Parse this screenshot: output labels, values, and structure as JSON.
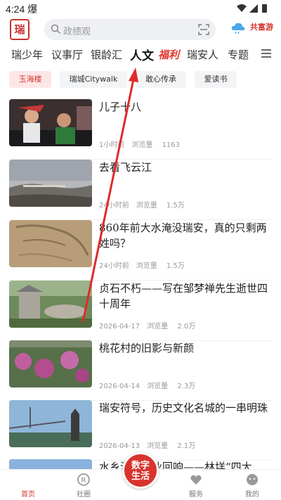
{
  "status_bar": {
    "time": "4:24",
    "extra_glyph": "爆"
  },
  "header": {
    "logo_text": "瑞",
    "search_placeholder": "政绩观",
    "promo_text": "共富游",
    "icons": {
      "search": "search-icon",
      "scan": "scan-icon",
      "weather": "cloud-icon"
    }
  },
  "tabs": [
    {
      "label": "瑞少年"
    },
    {
      "label": "议事厅"
    },
    {
      "label": "银龄汇"
    },
    {
      "label": "人文",
      "active": true
    },
    {
      "label": "福利",
      "highlight": true
    },
    {
      "label": "瑞安人"
    },
    {
      "label": "专题"
    }
  ],
  "sub_tags": [
    {
      "label": "玉海楼",
      "active": true
    },
    {
      "label": "瑞城Citywalk"
    },
    {
      "label": "敢心传承"
    },
    {
      "label": "爱读书"
    }
  ],
  "articles": [
    {
      "title": "儿子十八",
      "time": "1小时前",
      "views_label": "浏览量",
      "views": "1163"
    },
    {
      "title": "去看飞云江",
      "time": "24小时前",
      "views_label": "浏览量",
      "views": "1.5万"
    },
    {
      "title": "860年前大水淹没瑞安，真的只剩两姓吗？",
      "time": "24小时前",
      "views_label": "浏览量",
      "views": "1.5万"
    },
    {
      "title": "贞石不朽——写在邹梦禅先生逝世四十周年",
      "time": "2026-04-17",
      "views_label": "浏览量",
      "views": "2.0万"
    },
    {
      "title": "桃花村的旧影与新颜",
      "time": "2026-04-14",
      "views_label": "浏览量",
      "views": "2.3万"
    },
    {
      "title": "瑞安符号，历史文化名城的一串明珠",
      "time": "2026-04-13",
      "views_label": "浏览量",
      "views": "2.1万"
    },
    {
      "title": "水乡深处工业回响——林垟“四大"
    }
  ],
  "bottom_nav": [
    {
      "label": "首页",
      "active": true
    },
    {
      "label": "社圈"
    },
    {
      "label": "服务"
    },
    {
      "label": "我的"
    }
  ],
  "center_button": {
    "line1": "数字",
    "line2": "生活"
  },
  "colors": {
    "accent": "#d3382f",
    "annotation": "#e02a2a"
  }
}
